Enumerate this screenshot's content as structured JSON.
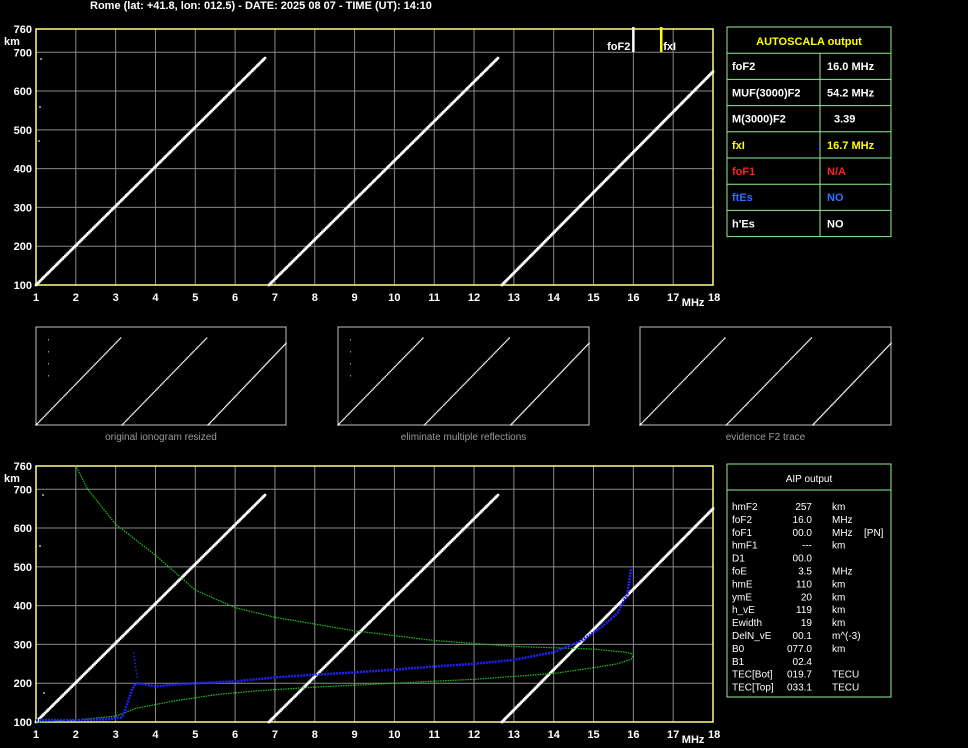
{
  "header": {
    "text": "Rome (lat: +41.8, lon: 012.5) - DATE: 2025 08 07 - TIME (UT): 14:10"
  },
  "chart_data": [
    {
      "type": "scatter",
      "x_unit": "MHz",
      "y_unit": "km",
      "xlim": [
        1,
        18
      ],
      "ylim": [
        100,
        760
      ],
      "xticks": [
        "1",
        "2",
        "3",
        "4",
        "5",
        "6",
        "7",
        "8",
        "9",
        "10",
        "11",
        "12",
        "13",
        "14",
        "15",
        "16",
        "17",
        "18"
      ],
      "yticks": [
        "100",
        "200",
        "300",
        "400",
        "500",
        "600",
        "700",
        "760"
      ],
      "grid": true,
      "traces": [
        {
          "start": [
            1.0,
            100
          ],
          "end": [
            6.75,
            685
          ]
        },
        {
          "start": [
            6.85,
            100
          ],
          "end": [
            12.6,
            685
          ]
        },
        {
          "start": [
            12.7,
            100
          ],
          "end": [
            18.0,
            650
          ]
        }
      ],
      "markers": [
        {
          "label": "foF2",
          "x": 16.0
        },
        {
          "label": "fxI",
          "x": 16.7
        }
      ]
    },
    {
      "type": "scatter",
      "x_unit": "MHz",
      "y_unit": "km",
      "xlim": [
        1,
        18
      ],
      "ylim": [
        100,
        760
      ],
      "xticks": [
        "1",
        "2",
        "3",
        "4",
        "5",
        "6",
        "7",
        "8",
        "9",
        "10",
        "11",
        "12",
        "13",
        "14",
        "15",
        "16",
        "17",
        "18"
      ],
      "yticks": [
        "100",
        "200",
        "300",
        "400",
        "500",
        "600",
        "700",
        "760"
      ],
      "grid": true,
      "traces": [
        {
          "start": [
            1.0,
            100
          ],
          "end": [
            6.75,
            685
          ]
        },
        {
          "start": [
            6.85,
            100
          ],
          "end": [
            12.6,
            685
          ]
        },
        {
          "start": [
            12.7,
            100
          ],
          "end": [
            18.0,
            650
          ]
        }
      ],
      "profile_blue": [
        [
          1.0,
          105
        ],
        [
          2.0,
          105
        ],
        [
          2.8,
          107
        ],
        [
          3.15,
          112
        ],
        [
          3.2,
          120
        ],
        [
          3.3,
          150
        ],
        [
          3.4,
          180
        ],
        [
          3.5,
          200
        ],
        [
          4.0,
          192
        ],
        [
          5.0,
          200
        ],
        [
          6.0,
          205
        ],
        [
          7.0,
          215
        ],
        [
          8.0,
          222
        ],
        [
          9.0,
          228
        ],
        [
          10.0,
          235
        ],
        [
          11.0,
          243
        ],
        [
          12.0,
          250
        ],
        [
          13.0,
          260
        ],
        [
          14.0,
          280
        ],
        [
          14.7,
          310
        ],
        [
          15.2,
          345
        ],
        [
          15.6,
          380
        ],
        [
          15.85,
          430
        ],
        [
          15.95,
          500
        ]
      ],
      "profile_blue_spike": [
        [
          3.45,
          280
        ],
        [
          3.5,
          240
        ],
        [
          3.55,
          210
        ]
      ],
      "profile_green_lower": [
        [
          1.0,
          100
        ],
        [
          2.0,
          105
        ],
        [
          3.0,
          115
        ],
        [
          3.5,
          135
        ],
        [
          4.5,
          155
        ],
        [
          5.5,
          170
        ],
        [
          6.5,
          180
        ],
        [
          8.0,
          190
        ],
        [
          10.0,
          200
        ],
        [
          12.0,
          210
        ],
        [
          14.0,
          225
        ],
        [
          15.0,
          240
        ],
        [
          15.6,
          250
        ],
        [
          15.95,
          262
        ],
        [
          16.0,
          275
        ],
        [
          15.8,
          280
        ],
        [
          15.0,
          288
        ],
        [
          13.0,
          295
        ],
        [
          11.0,
          310
        ],
        [
          9.0,
          335
        ],
        [
          7.0,
          370
        ],
        [
          6.0,
          395
        ],
        [
          5.0,
          440
        ],
        [
          4.0,
          530
        ],
        [
          3.0,
          610
        ],
        [
          2.3,
          700
        ],
        [
          2.0,
          760
        ]
      ]
    }
  ],
  "thumbnails": [
    {
      "caption": "original ionogram resized"
    },
    {
      "caption": "eliminate multiple reflections"
    },
    {
      "caption": "evidence F2 trace"
    }
  ],
  "autoscala": {
    "title": "AUTOSCALA output",
    "rows": [
      {
        "label": "foF2",
        "value": "16.0 MHz",
        "color": "#ffffff"
      },
      {
        "label": "MUF(3000)F2",
        "value": "54.2 MHz",
        "color": "#ffffff"
      },
      {
        "label": "M(3000)F2",
        "value": "3.39",
        "color": "#ffffff"
      },
      {
        "label": "fxI",
        "value": "16.7 MHz",
        "color": "#ffff00"
      },
      {
        "label": "foF1",
        "value": "N/A",
        "color": "#ff2020"
      },
      {
        "label": "ftEs",
        "value": "NO",
        "color": "#3070ff"
      },
      {
        "label": "h'Es",
        "value": "NO",
        "color": "#ffffff"
      }
    ]
  },
  "aip": {
    "title": "AIP output",
    "rows": [
      {
        "name": "hmF2",
        "val": "257",
        "unit": "km",
        "extra": ""
      },
      {
        "name": "foF2",
        "val": "16.0",
        "unit": "MHz",
        "extra": ""
      },
      {
        "name": "foF1",
        "val": "00.0",
        "unit": "MHz",
        "extra": "[PN]"
      },
      {
        "name": "hmF1",
        "val": "---",
        "unit": "km",
        "extra": ""
      },
      {
        "name": "D1",
        "val": "00.0",
        "unit": "",
        "extra": ""
      },
      {
        "name": "foE",
        "val": "3.5",
        "unit": "MHz",
        "extra": ""
      },
      {
        "name": "hmE",
        "val": "110",
        "unit": "km",
        "extra": ""
      },
      {
        "name": "ymE",
        "val": "20",
        "unit": "km",
        "extra": ""
      },
      {
        "name": "h_vE",
        "val": "119",
        "unit": "km",
        "extra": ""
      },
      {
        "name": "Ewidth",
        "val": "19",
        "unit": "km",
        "extra": ""
      },
      {
        "name": "DelN_vE",
        "val": "00.1",
        "unit": "m^(-3)",
        "extra": ""
      },
      {
        "name": "B0",
        "val": "077.0",
        "unit": "km",
        "extra": ""
      },
      {
        "name": "B1",
        "val": "02.4",
        "unit": "",
        "extra": ""
      },
      {
        "name": "TEC[Bot]",
        "val": "019.7",
        "unit": "TECU",
        "extra": ""
      },
      {
        "name": "TEC[Top]",
        "val": "033.1",
        "unit": "TECU",
        "extra": ""
      }
    ]
  },
  "colors": {
    "axis": "#ffff80",
    "grid": "#8a8a8a",
    "trace": "#ffffff",
    "panel_border": "#90ee90",
    "thumb_border": "#c0c0c0",
    "profile_blue": "#2020ff",
    "profile_green": "#20c020",
    "marker_yellow": "#ffff00"
  }
}
